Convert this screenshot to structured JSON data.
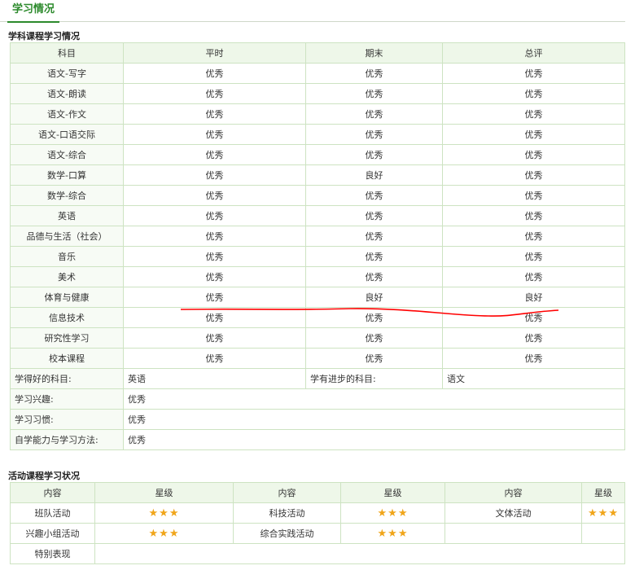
{
  "tab": {
    "label": "学习情况"
  },
  "subject_section": {
    "title": "学科课程学习情况",
    "headers": [
      "科目",
      "平时",
      "期末",
      "总评"
    ],
    "rows": [
      {
        "subject": "语文-写字",
        "usual": "优秀",
        "final": "优秀",
        "overall": "优秀"
      },
      {
        "subject": "语文-朗读",
        "usual": "优秀",
        "final": "优秀",
        "overall": "优秀"
      },
      {
        "subject": "语文-作文",
        "usual": "优秀",
        "final": "优秀",
        "overall": "优秀"
      },
      {
        "subject": "语文-口语交际",
        "usual": "优秀",
        "final": "优秀",
        "overall": "优秀"
      },
      {
        "subject": "语文-综合",
        "usual": "优秀",
        "final": "优秀",
        "overall": "优秀"
      },
      {
        "subject": "数学-口算",
        "usual": "优秀",
        "final": "良好",
        "overall": "优秀"
      },
      {
        "subject": "数学-综合",
        "usual": "优秀",
        "final": "优秀",
        "overall": "优秀"
      },
      {
        "subject": "英语",
        "usual": "优秀",
        "final": "优秀",
        "overall": "优秀"
      },
      {
        "subject": "品德与生活（社会）",
        "usual": "优秀",
        "final": "优秀",
        "overall": "优秀"
      },
      {
        "subject": "音乐",
        "usual": "优秀",
        "final": "优秀",
        "overall": "优秀"
      },
      {
        "subject": "美术",
        "usual": "优秀",
        "final": "优秀",
        "overall": "优秀"
      },
      {
        "subject": "体育与健康",
        "usual": "优秀",
        "final": "良好",
        "overall": "良好"
      },
      {
        "subject": "信息技术",
        "usual": "优秀",
        "final": "优秀",
        "overall": "优秀"
      },
      {
        "subject": "研究性学习",
        "usual": "优秀",
        "final": "优秀",
        "overall": "优秀"
      },
      {
        "subject": "校本课程",
        "usual": "优秀",
        "final": "优秀",
        "overall": "优秀"
      }
    ],
    "best_subject_label": "学得好的科目:",
    "best_subject_value": "英语",
    "progress_subject_label": "学有进步的科目:",
    "progress_subject_value": "语文",
    "interest_label": "学习兴趣:",
    "interest_value": "优秀",
    "habit_label": "学习习惯:",
    "habit_value": "优秀",
    "self_study_label": "自学能力与学习方法:",
    "self_study_value": "优秀"
  },
  "activity_section": {
    "title": "活动课程学习状况",
    "headers": [
      "内容",
      "星级",
      "内容",
      "星级",
      "内容",
      "星级"
    ],
    "row1": [
      {
        "content": "班队活动",
        "stars": 3
      },
      {
        "content": "科技活动",
        "stars": 3
      },
      {
        "content": "文体活动",
        "stars": 3
      }
    ],
    "row2": [
      {
        "content": "兴趣小组活动",
        "stars": 3
      },
      {
        "content": "综合实践活动",
        "stars": 3
      },
      {
        "content": "",
        "stars": 0
      }
    ],
    "special_label": "特别表现",
    "special_value": ""
  },
  "colors": {
    "accent": "#2c8a2c",
    "border": "#cde3c2",
    "header_bg": "#eef7e9",
    "star": "#f0a51a",
    "annotation": "#ff0000"
  }
}
